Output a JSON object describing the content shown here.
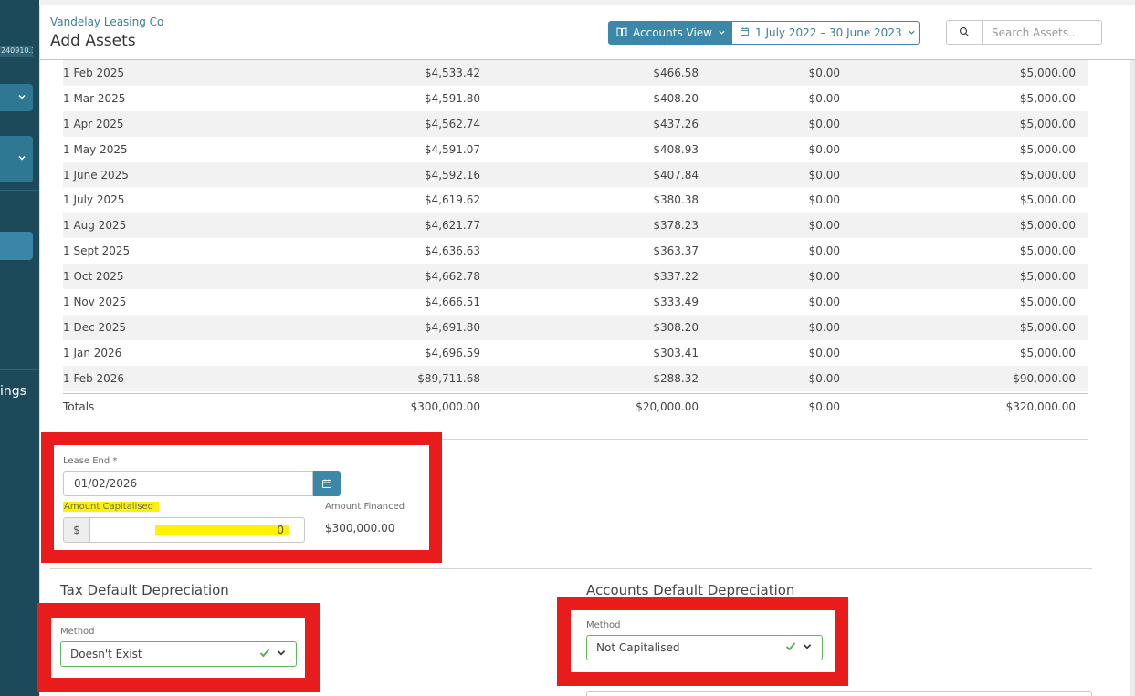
{
  "sidebar": {
    "version": "240910.3",
    "settings_label": "ings"
  },
  "header": {
    "company": "Vandelay Leasing Co",
    "title": "Add Assets",
    "view_label": "Accounts View",
    "date_range": "1 July 2022 – 30 June 2023",
    "search_placeholder": "Search Assets..."
  },
  "schedule": {
    "rows": [
      {
        "date": "1 Feb 2025",
        "a": "$4,533.42",
        "b": "$466.58",
        "c": "$0.00",
        "d": "$5,000.00"
      },
      {
        "date": "1 Mar 2025",
        "a": "$4,591.80",
        "b": "$408.20",
        "c": "$0.00",
        "d": "$5,000.00"
      },
      {
        "date": "1 Apr 2025",
        "a": "$4,562.74",
        "b": "$437.26",
        "c": "$0.00",
        "d": "$5,000.00"
      },
      {
        "date": "1 May 2025",
        "a": "$4,591.07",
        "b": "$408.93",
        "c": "$0.00",
        "d": "$5,000.00"
      },
      {
        "date": "1 June 2025",
        "a": "$4,592.16",
        "b": "$407.84",
        "c": "$0.00",
        "d": "$5,000.00"
      },
      {
        "date": "1 July 2025",
        "a": "$4,619.62",
        "b": "$380.38",
        "c": "$0.00",
        "d": "$5,000.00"
      },
      {
        "date": "1 Aug 2025",
        "a": "$4,621.77",
        "b": "$378.23",
        "c": "$0.00",
        "d": "$5,000.00"
      },
      {
        "date": "1 Sept 2025",
        "a": "$4,636.63",
        "b": "$363.37",
        "c": "$0.00",
        "d": "$5,000.00"
      },
      {
        "date": "1 Oct 2025",
        "a": "$4,662.78",
        "b": "$337.22",
        "c": "$0.00",
        "d": "$5,000.00"
      },
      {
        "date": "1 Nov 2025",
        "a": "$4,666.51",
        "b": "$333.49",
        "c": "$0.00",
        "d": "$5,000.00"
      },
      {
        "date": "1 Dec 2025",
        "a": "$4,691.80",
        "b": "$308.20",
        "c": "$0.00",
        "d": "$5,000.00"
      },
      {
        "date": "1 Jan 2026",
        "a": "$4,696.59",
        "b": "$303.41",
        "c": "$0.00",
        "d": "$5,000.00"
      },
      {
        "date": "1 Feb 2026",
        "a": "$89,711.68",
        "b": "$288.32",
        "c": "$0.00",
        "d": "$90,000.00"
      }
    ],
    "totals": {
      "label": "Totals",
      "a": "$300,000.00",
      "b": "$20,000.00",
      "c": "$0.00",
      "d": "$320,000.00"
    }
  },
  "lease": {
    "end_label": "Lease End *",
    "end_value": "01/02/2026",
    "cap_label": "Amount Capitalised",
    "currency": "$",
    "cap_value": "0",
    "fin_label": "Amount Financed",
    "fin_value": "$300,000.00"
  },
  "tax": {
    "title": "Tax Default Depreciation",
    "method_label": "Method",
    "method_value": "Doesn't Exist"
  },
  "accounts": {
    "title": "Accounts Default Depreciation",
    "method_label": "Method",
    "method_value": "Not Capitalised"
  },
  "colors": {
    "sidebar": "#1d4a5b",
    "accent": "#3b88a8",
    "annotation_red": "#e81c1c",
    "highlight_yellow": "#fff200",
    "valid_green": "#5db85d"
  }
}
